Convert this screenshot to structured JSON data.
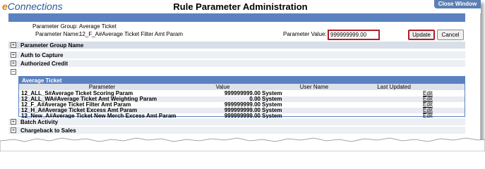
{
  "header": {
    "logo_e": "e",
    "logo_rest": "Connections",
    "title": "Rule Parameter Administration",
    "close_label": "Close Window"
  },
  "parameter": {
    "group_label": "Parameter Group:",
    "group_value": "Average Ticket",
    "name_label": "Parameter Name:",
    "name_value": "12_F_A#Average Ticket Filter Amt Param",
    "value_label": "Parameter Value:",
    "value_input": "999999999.00"
  },
  "buttons": {
    "update": "Update",
    "cancel": "Cancel"
  },
  "groups": {
    "header": "Parameter Group Name",
    "items": [
      "Auth to Capture",
      "Authorized Credit",
      "Average Ticket",
      "Batch Activity",
      "Chargeback to Sales"
    ]
  },
  "toggles": {
    "expand": "+",
    "collapse": "−"
  },
  "average_ticket": {
    "columns": [
      "Parameter",
      "Value",
      "User Name",
      "Last Updated"
    ],
    "rows": [
      {
        "parameter": "12_ALL_S#Average Ticket Scoring Param",
        "value": "999999999.00",
        "user": "System",
        "last_updated": "",
        "action": "Edit"
      },
      {
        "parameter": "12_ALL_WA#Average Ticket Amt Weighting Param",
        "value": "0.00",
        "user": "System",
        "last_updated": "",
        "action": "Edit"
      },
      {
        "parameter": "12_F_A#Average Ticket Filter Amt Param",
        "value": "999999999.00",
        "user": "System",
        "last_updated": "",
        "action": "Edit"
      },
      {
        "parameter": "12_H_A#Average Ticket Excess Amt Param",
        "value": "999999999.00",
        "user": "System",
        "last_updated": "",
        "action": "Edit"
      },
      {
        "parameter": "12_New_A#Average Ticket New Merch Excess Amt Param",
        "value": "999999999.00",
        "user": "System",
        "last_updated": "",
        "action": "Edit"
      }
    ]
  },
  "colors": {
    "accent_blue": "#5b82c0",
    "highlight_red": "#b01e2a",
    "logo_orange": "#e07b18"
  }
}
